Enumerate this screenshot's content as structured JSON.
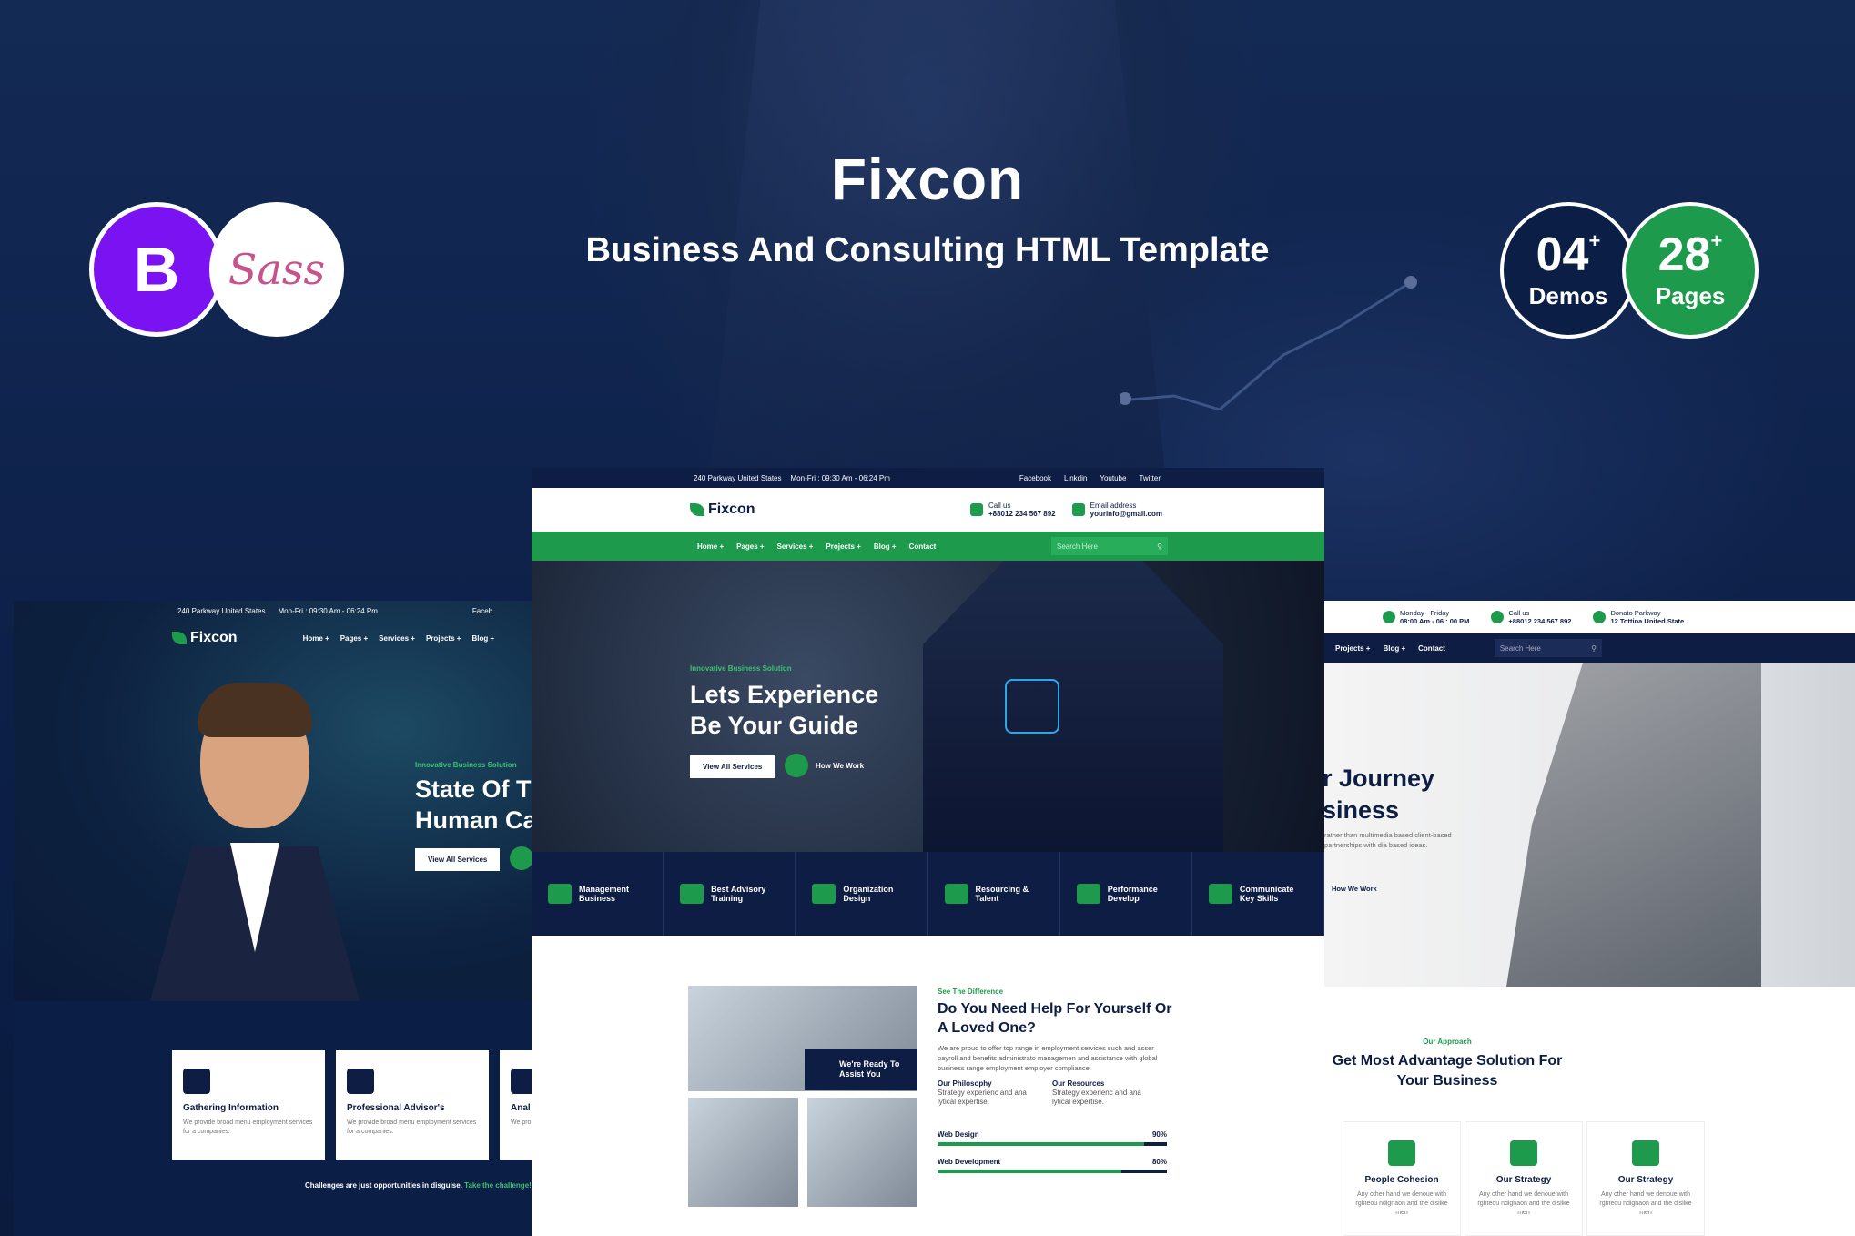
{
  "banner": {
    "title": "Fixcon",
    "subtitle": "Business And Consulting HTML Template",
    "bootstrap_letter": "B",
    "sass_text": "Sass",
    "stats": [
      {
        "num": "04",
        "plus": "+",
        "label": "Demos"
      },
      {
        "num": "28",
        "plus": "+",
        "label": "Pages"
      }
    ]
  },
  "center": {
    "topbar": {
      "address": "240 Parkway United States",
      "hours": "Mon-Fri : 09:30 Am - 06:24 Pm",
      "social": [
        "Facebook",
        "Linkdin",
        "Youtube",
        "Twitter"
      ]
    },
    "logo": "Fixcon",
    "call_label": "Call us",
    "call_value": "+88012 234 567 892",
    "email_label": "Email address",
    "email_value": "yourinfo@gmail.com",
    "nav": [
      "Home +",
      "Pages +",
      "Services +",
      "Projects +",
      "Blog +",
      "Contact"
    ],
    "search_placeholder": "Search Here",
    "hero_kicker": "Innovative Business Solution",
    "hero_line1": "Lets Experience",
    "hero_line2": "Be Your Guide",
    "hero_btn": "View All Services",
    "hero_play": "How We Work",
    "features": [
      {
        "l1": "Management",
        "l2": "Business"
      },
      {
        "l1": "Best Advisory",
        "l2": "Training"
      },
      {
        "l1": "Organization",
        "l2": "Design"
      },
      {
        "l1": "Resourcing &",
        "l2": "Talent"
      },
      {
        "l1": "Performance",
        "l2": "Develop"
      },
      {
        "l1": "Communicate",
        "l2": "Key Skills"
      }
    ],
    "ready_line1": "We're Ready To",
    "ready_line2": "Assist You",
    "about_kicker": "See The Difference",
    "about_title": "Do You Need Help For Yourself Or A Loved One?",
    "about_text": "We are proud to offer top range in employment services such and asser payroll and benefits administrato managemen and assistance with global business range employment employer compliance.",
    "philosophy_title": "Our Philosophy",
    "philosophy_text": "Strategy experienc and ana lytical expertise.",
    "resources_title": "Our Resources",
    "resources_text": "Strategy experienc and ana lytical expertise.",
    "skills": [
      {
        "name": "Web Design",
        "label": "90%",
        "value": 0.9
      },
      {
        "name": "Web Development",
        "label": "80%",
        "value": 0.8
      }
    ]
  },
  "left": {
    "address": "240 Parkway United States",
    "hours": "Mon-Fri : 09:30 Am - 06:24 Pm",
    "social_first": "Faceb",
    "logo": "Fixcon",
    "nav": [
      "Home +",
      "Pages +",
      "Services +",
      "Projects +",
      "Blog +"
    ],
    "hero_kicker": "Innovative Business Solution",
    "hero_line1": "State Of T",
    "hero_line2": "Human Ca",
    "hero_btn": "View All Services",
    "cards": [
      {
        "title": "Gathering Information",
        "text": "We provide broad menu employment services for a companies."
      },
      {
        "title": "Professional Advisor's",
        "text": "We provide broad menu employment services for a companies."
      },
      {
        "title": "Anal",
        "text": "We pro servic"
      }
    ],
    "footer_text": "Challenges are just opportunities in disguise.",
    "footer_link": "Take the challenge!"
  },
  "right": {
    "hours_label": "Monday - Friday",
    "hours_value": "08:00 Am - 06 : 00 PM",
    "call_label": "Call us",
    "call_value": "+88012 234 567 892",
    "addr_label": "Donato Parkway",
    "addr_value": "12 Tottina United State",
    "nav": [
      "Projects +",
      "Blog +",
      "Contact"
    ],
    "search_placeholder": "Search Here",
    "hero_line1": "r Journey",
    "hero_line2": "siness",
    "hero_text": "rather than multimedia based client-based partnerships with dia based ideas.",
    "hero_link": "How We Work",
    "section_kicker": "Our Approach",
    "section_title": "Get Most Advantage Solution For Your Business",
    "cards": [
      {
        "title": "People Cohesion",
        "text": "Any other hand we denoue with rghteou ndignaon and the dislike men"
      },
      {
        "title": "Our Strategy",
        "text": "Any other hand we denoue with rghteou ndignaon and the dislike men"
      },
      {
        "title": "Our Strategy",
        "text": "Any other hand we denoue with rghteou ndignaon and the dislike men"
      }
    ]
  }
}
